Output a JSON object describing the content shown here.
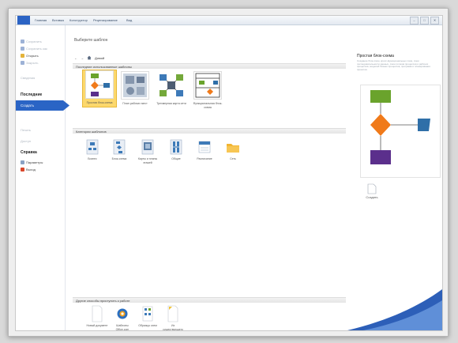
{
  "ribbon": {
    "file_tab": "",
    "tabs": [
      "Главная",
      "Вставка",
      "Конструктор",
      "Рецензирование",
      "Вид"
    ],
    "window_buttons": [
      "–",
      "□",
      "✕"
    ]
  },
  "nav": {
    "items": [
      {
        "label": "Сохранить",
        "dim": true,
        "color": "#7d99c7"
      },
      {
        "label": "Сохранить как",
        "dim": true,
        "color": "#7d99c7"
      },
      {
        "label": "Открыть",
        "dim": false,
        "color": "#e4b33a"
      },
      {
        "label": "Закрыть",
        "dim": true,
        "color": "#7d99c7"
      }
    ],
    "info": "Сведения",
    "recent": "Последние",
    "create": "Создать",
    "print": "Печать",
    "share": "Доступ",
    "help": "Справка",
    "options": "Параметры",
    "exit": "Выход"
  },
  "main": {
    "title": "Выберите шаблон",
    "breadcrumb_back": "←",
    "breadcrumb_forward": "→",
    "breadcrumb_home_icon": "home-icon",
    "breadcrumb_home": "Домой",
    "recent_section": "Последние использованные шаблоны",
    "recent_templates": [
      {
        "label": "Простая блок-схема",
        "selected": true
      },
      {
        "label": "План рабочих мест",
        "selected": false
      },
      {
        "label": "Трехмерная карта сети",
        "selected": false
      },
      {
        "label": "Функциональная блок-схема",
        "selected": false
      }
    ],
    "categories_section": "Категории шаблонов",
    "categories": [
      {
        "label": "Бизнес"
      },
      {
        "label": "Блок-схема"
      },
      {
        "label": "Карты и планы этажей"
      },
      {
        "label": "Общие"
      },
      {
        "label": "Расписание"
      },
      {
        "label": "Сеть"
      }
    ],
    "other_section": "Другие способы приступить к работе",
    "other": [
      {
        "label": "Новый документ"
      },
      {
        "label": "Шаблоны Office.com"
      },
      {
        "label": "Образцы схем"
      },
      {
        "label": "Из существующего"
      }
    ]
  },
  "right_pane": {
    "title": "Простая блок-схема",
    "description": "Создание блок-схем, кросс-функциональных схем, схем последовательности данных, схем потоков процессов и рабочих процессов, моделей бизнес-процессов, программ и планирования проектов.",
    "create_label": "Создать"
  },
  "colors": {
    "accent": "#2a64c5",
    "selected_tile": "#fcd86c",
    "flow_green": "#6aa32c",
    "flow_orange": "#f07a1a",
    "flow_blue": "#2f6fa8",
    "flow_purple": "#5b2f8c"
  }
}
